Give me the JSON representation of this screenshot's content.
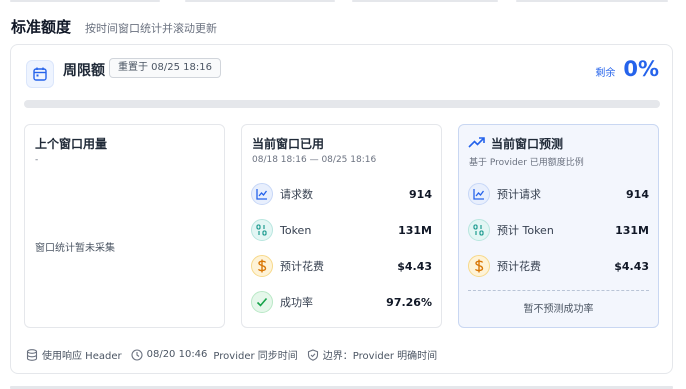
{
  "section": {
    "title": "标准额度",
    "subtitle": "按时间窗口统计并滚动更新"
  },
  "quota": {
    "title": "周限额",
    "reset_badge": "重置于 08/25 18:16",
    "remaining_label": "剩余",
    "remaining_pct": "0%",
    "usage_fraction": 0
  },
  "cards": {
    "previous": {
      "title": "上个窗口用量",
      "subtitle": "-",
      "empty_note": "窗口统计暂未采集"
    },
    "current": {
      "title": "当前窗口已用",
      "subtitle": "08/18 18:16 — 08/25 18:16",
      "metrics": [
        {
          "label": "请求数",
          "value": "914",
          "icon": "chart-icon"
        },
        {
          "label": "Token",
          "value": "131M",
          "icon": "binary-icon"
        },
        {
          "label": "预计花费",
          "value": "$4.43",
          "icon": "dollar-icon"
        },
        {
          "label": "成功率",
          "value": "97.26%",
          "icon": "check-icon"
        }
      ]
    },
    "forecast": {
      "title": "当前窗口预测",
      "subtitle": "基于 Provider 已用额度比例",
      "metrics": [
        {
          "label": "预计请求",
          "value": "914",
          "icon": "chart-icon"
        },
        {
          "label": "预计 Token",
          "value": "131M",
          "icon": "binary-icon"
        },
        {
          "label": "预计花费",
          "value": "$4.43",
          "icon": "dollar-icon"
        }
      ],
      "note": "暂不预测成功率"
    }
  },
  "footer": {
    "source": "使用响应 Header",
    "sync_time": "08/20 10:46",
    "sync_label": "Provider 同步时间",
    "boundary": "边界：Provider 明确时间"
  },
  "colors": {
    "accent": "#2563eb",
    "forecast_bg": "#f3f6fd",
    "teal": "#0d9488",
    "amber": "#d97706",
    "green": "#16a34a"
  }
}
